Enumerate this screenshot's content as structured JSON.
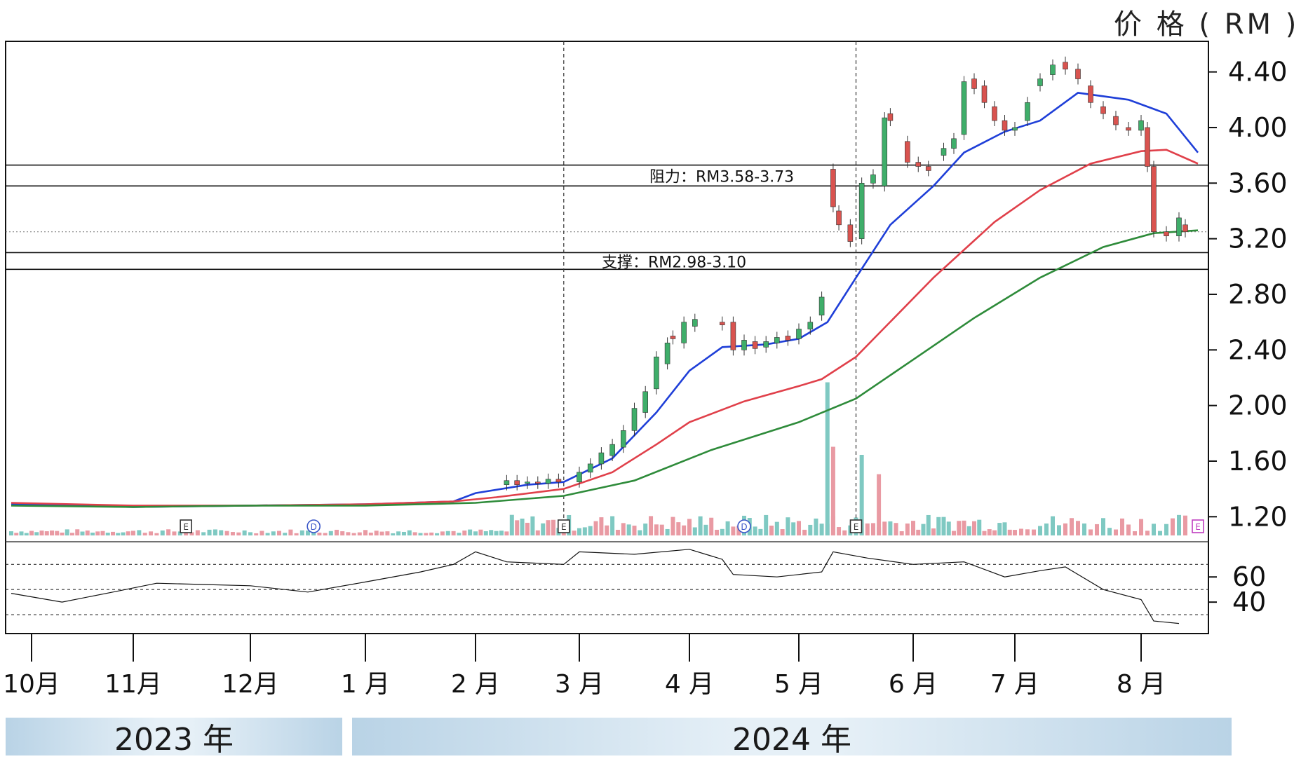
{
  "header": {
    "unit_label": "价 格 ( RM )"
  },
  "years": [
    "2023 年",
    "2024 年"
  ],
  "chart_data": {
    "type": "candlestick",
    "x_months": [
      "10月",
      "11月",
      "12月",
      "1 月",
      "2 月",
      "3 月",
      "4 月",
      "5 月",
      "6 月",
      "7 月",
      "8 月"
    ],
    "price_axis": {
      "ticks": [
        "4.40",
        "4.00",
        "3.60",
        "3.20",
        "2.80",
        "2.40",
        "2.00",
        "1.60",
        "1.20"
      ],
      "ylim": [
        1.02,
        4.62
      ]
    },
    "rsi_axis": {
      "ticks": [
        "60",
        "40"
      ],
      "guides": [
        70,
        50,
        30
      ],
      "ylim": [
        15,
        88
      ]
    },
    "resistance": {
      "label": "阻力：RM3.58-3.73",
      "low": 3.58,
      "high": 3.73
    },
    "support": {
      "label": "支撑：RM2.98-3.10",
      "low": 2.98,
      "high": 3.1
    },
    "events": [
      {
        "month": 1.45,
        "label": "E",
        "color": "#333333"
      },
      {
        "month": 2.55,
        "label": "D",
        "color": "#3a56c8"
      },
      {
        "month": 4.85,
        "label": "E",
        "color": "#333333"
      },
      {
        "month": 6.5,
        "label": "D",
        "color": "#3a56c8"
      },
      {
        "month": 7.5,
        "label": "E",
        "color": "#333333"
      },
      {
        "month": 10.45,
        "label": "E",
        "color": "#c03cc0"
      }
    ],
    "divider_months": [
      4.85,
      7.5
    ],
    "ma_series": [
      {
        "color": "#1f3fd8",
        "points": [
          [
            -0.2,
            1.29
          ],
          [
            1,
            1.27
          ],
          [
            2,
            1.28
          ],
          [
            3,
            1.29
          ],
          [
            3.8,
            1.31
          ],
          [
            4,
            1.37
          ],
          [
            4.5,
            1.43
          ],
          [
            4.85,
            1.45
          ],
          [
            5.3,
            1.62
          ],
          [
            5.7,
            1.95
          ],
          [
            6,
            2.25
          ],
          [
            6.3,
            2.42
          ],
          [
            6.7,
            2.44
          ],
          [
            7,
            2.48
          ],
          [
            7.25,
            2.6
          ],
          [
            7.5,
            2.92
          ],
          [
            7.8,
            3.3
          ],
          [
            8.2,
            3.58
          ],
          [
            8.5,
            3.82
          ],
          [
            8.9,
            3.97
          ],
          [
            9.2,
            4.05
          ],
          [
            9.5,
            4.25
          ],
          [
            9.9,
            4.2
          ],
          [
            10.2,
            4.1
          ],
          [
            10.45,
            3.82
          ]
        ]
      },
      {
        "color": "#e0404a",
        "points": [
          [
            -0.2,
            1.3
          ],
          [
            1,
            1.28
          ],
          [
            2,
            1.28
          ],
          [
            3,
            1.29
          ],
          [
            3.8,
            1.31
          ],
          [
            4.2,
            1.34
          ],
          [
            4.85,
            1.4
          ],
          [
            5.3,
            1.52
          ],
          [
            5.7,
            1.72
          ],
          [
            6,
            1.88
          ],
          [
            6.5,
            2.03
          ],
          [
            7,
            2.14
          ],
          [
            7.2,
            2.19
          ],
          [
            7.5,
            2.35
          ],
          [
            8.2,
            2.92
          ],
          [
            8.8,
            3.32
          ],
          [
            9.2,
            3.55
          ],
          [
            9.6,
            3.74
          ],
          [
            10,
            3.83
          ],
          [
            10.2,
            3.84
          ],
          [
            10.45,
            3.74
          ]
        ]
      },
      {
        "color": "#2e8b3a",
        "points": [
          [
            -0.2,
            1.28
          ],
          [
            1,
            1.27
          ],
          [
            2,
            1.28
          ],
          [
            3,
            1.28
          ],
          [
            4,
            1.3
          ],
          [
            4.85,
            1.35
          ],
          [
            5.5,
            1.46
          ],
          [
            6.2,
            1.68
          ],
          [
            7,
            1.88
          ],
          [
            7.5,
            2.05
          ],
          [
            8,
            2.33
          ],
          [
            8.6,
            2.63
          ],
          [
            9.2,
            2.92
          ],
          [
            9.7,
            3.14
          ],
          [
            10.1,
            3.24
          ],
          [
            10.45,
            3.26
          ]
        ]
      }
    ],
    "candles": [
      [
        4.3,
        1.43,
        1.46
      ],
      [
        4.4,
        1.46,
        1.43
      ],
      [
        4.5,
        1.44,
        1.45
      ],
      [
        4.6,
        1.45,
        1.44
      ],
      [
        4.7,
        1.44,
        1.47
      ],
      [
        4.8,
        1.47,
        1.45
      ],
      [
        5.0,
        1.45,
        1.52
      ],
      [
        5.1,
        1.52,
        1.58
      ],
      [
        5.2,
        1.58,
        1.66
      ],
      [
        5.3,
        1.64,
        1.72
      ],
      [
        5.4,
        1.7,
        1.82
      ],
      [
        5.5,
        1.82,
        1.98
      ],
      [
        5.6,
        1.95,
        2.1
      ],
      [
        5.7,
        2.12,
        2.35
      ],
      [
        5.8,
        2.3,
        2.45
      ],
      [
        5.85,
        2.5,
        2.48
      ],
      [
        5.95,
        2.45,
        2.6
      ],
      [
        6.05,
        2.57,
        2.62
      ],
      [
        6.3,
        2.6,
        2.58
      ],
      [
        6.4,
        2.6,
        2.4
      ],
      [
        6.5,
        2.4,
        2.47
      ],
      [
        6.6,
        2.46,
        2.41
      ],
      [
        6.7,
        2.42,
        2.46
      ],
      [
        6.8,
        2.45,
        2.49
      ],
      [
        6.9,
        2.5,
        2.47
      ],
      [
        7.0,
        2.48,
        2.55
      ],
      [
        7.1,
        2.55,
        2.6
      ],
      [
        7.2,
        2.65,
        2.78
      ],
      [
        7.3,
        3.7,
        3.43
      ],
      [
        7.35,
        3.4,
        3.3
      ],
      [
        7.45,
        3.3,
        3.18
      ],
      [
        7.55,
        3.2,
        3.6
      ],
      [
        7.65,
        3.6,
        3.66
      ],
      [
        7.75,
        3.58,
        4.07
      ],
      [
        7.8,
        4.1,
        4.05
      ],
      [
        7.95,
        3.9,
        3.75
      ],
      [
        8.05,
        3.75,
        3.72
      ],
      [
        8.15,
        3.72,
        3.69
      ],
      [
        8.3,
        3.8,
        3.85
      ],
      [
        8.4,
        3.85,
        3.92
      ],
      [
        8.5,
        3.95,
        4.33
      ],
      [
        8.6,
        4.35,
        4.28
      ],
      [
        8.7,
        4.3,
        4.18
      ],
      [
        8.8,
        4.15,
        4.05
      ],
      [
        8.9,
        4.05,
        3.98
      ],
      [
        9.0,
        3.98,
        4.0
      ],
      [
        9.1,
        4.05,
        4.18
      ],
      [
        9.2,
        4.3,
        4.35
      ],
      [
        9.3,
        4.38,
        4.45
      ],
      [
        9.4,
        4.47,
        4.42
      ],
      [
        9.5,
        4.42,
        4.35
      ],
      [
        9.6,
        4.3,
        4.18
      ],
      [
        9.7,
        4.15,
        4.1
      ],
      [
        9.8,
        4.08,
        4.02
      ],
      [
        9.9,
        4.0,
        3.98
      ],
      [
        10.0,
        3.98,
        4.05
      ],
      [
        10.05,
        4.0,
        3.72
      ],
      [
        10.1,
        3.72,
        3.25
      ],
      [
        10.2,
        3.25,
        3.22
      ],
      [
        10.3,
        3.22,
        3.35
      ],
      [
        10.35,
        3.3,
        3.25
      ]
    ],
    "volume_spikes": [
      [
        7.25,
        0.95
      ],
      [
        7.3,
        0.55
      ],
      [
        7.55,
        0.5
      ],
      [
        7.7,
        0.38
      ]
    ]
  }
}
